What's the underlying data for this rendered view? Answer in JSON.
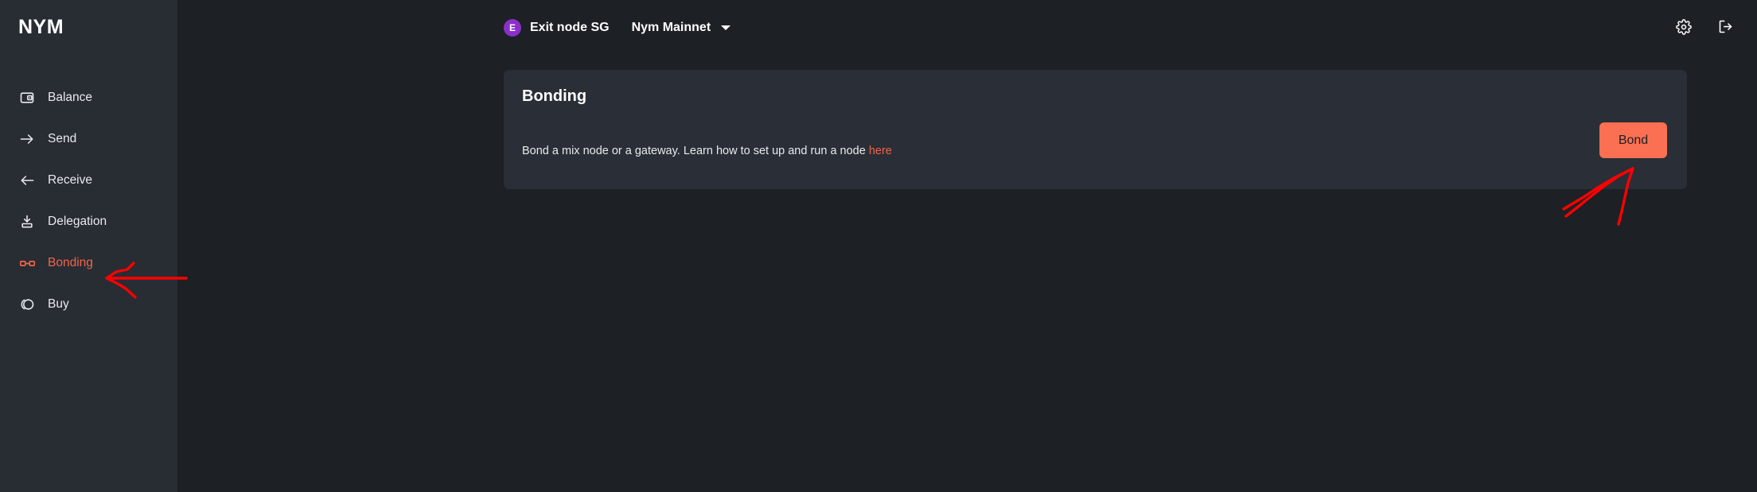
{
  "app": {
    "brand": "NYM",
    "accent_color": "#F0654A",
    "button_color": "#FB7052",
    "sidebar_bg": "#282C33",
    "main_bg": "#1D2025",
    "card_bg": "#2A2E36",
    "avatar_color": "#8B2FC9",
    "annotation_color": "#FF0000"
  },
  "sidebar": {
    "items": [
      {
        "label": "Balance",
        "icon": "wallet-icon",
        "active": false
      },
      {
        "label": "Send",
        "icon": "arrow-right-icon",
        "active": false
      },
      {
        "label": "Receive",
        "icon": "arrow-left-icon",
        "active": false
      },
      {
        "label": "Delegation",
        "icon": "download-icon",
        "active": false
      },
      {
        "label": "Bonding",
        "icon": "link-icon",
        "active": true
      },
      {
        "label": "Buy",
        "icon": "coin-icon",
        "active": false
      }
    ]
  },
  "header": {
    "avatar_initial": "E",
    "node_name": "Exit node SG",
    "network": "Nym Mainnet",
    "network_dropdown_icon": "chevron-down-icon",
    "settings_icon": "gear-icon",
    "logout_icon": "logout-icon"
  },
  "main": {
    "card": {
      "title": "Bonding",
      "description_prefix": "Bond a mix node or a gateway. Learn how to set up and run a node ",
      "description_link": "here",
      "bond_label": "Bond"
    }
  },
  "annotations": {
    "sidebar_arrow": "red-arrow-pointing-left-at-bonding",
    "bond_arrow": "red-arrow-pointing-up-right-at-bond-button"
  }
}
